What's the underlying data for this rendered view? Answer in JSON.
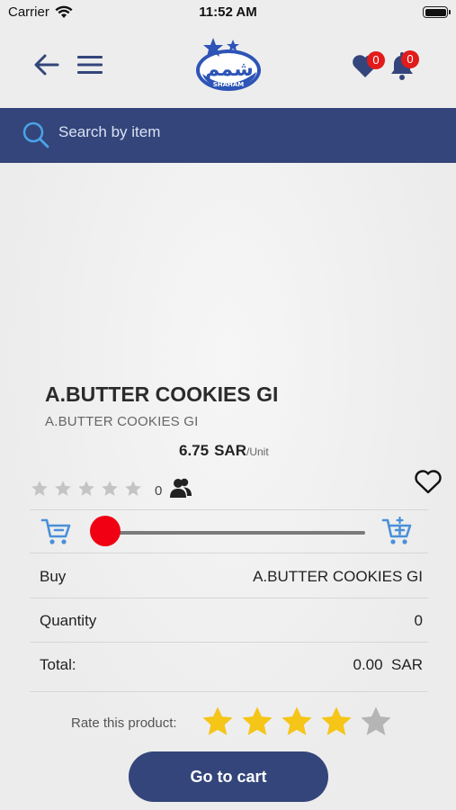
{
  "status_bar": {
    "carrier": "Carrier",
    "time": "11:52 AM"
  },
  "header": {
    "logo_text": "شمم",
    "logo_subtext": "SHAHAM",
    "favorites_count": "0",
    "notifications_count": "0"
  },
  "search": {
    "placeholder": "Search by item"
  },
  "product": {
    "name": "A.BUTTER COOKIES GI",
    "subtitle": "A.BUTTER COOKIES GI",
    "price": "6.75",
    "currency": "SAR",
    "unit": "/Unit",
    "rating_count": "0",
    "average_rating": 0,
    "quantity_slider_fraction": 0
  },
  "summary": {
    "buy_label": "Buy",
    "buy_value": "A.BUTTER COOKIES GI",
    "quantity_label": "Quantity",
    "quantity_value": "0",
    "total_label": "Total:",
    "total_value": "0.00  SAR"
  },
  "rate": {
    "label": "Rate this product:",
    "selected_stars": 4,
    "max_stars": 5
  },
  "cart_button": {
    "label": "Go to cart"
  },
  "colors": {
    "brand_navy": "#33457a",
    "accent_blue": "#4a90d9",
    "badge_red": "#e11b1b",
    "slider_red": "#f00012",
    "star_gold": "#f5c518",
    "star_gray": "#b5b5b5"
  },
  "icons": {
    "back": "arrow-left-icon",
    "menu": "hamburger-menu-icon",
    "favorites": "heart-icon",
    "notifications": "bell-icon",
    "search": "search-icon",
    "users": "users-icon",
    "cart_remove": "cart-remove-icon",
    "cart_add": "cart-add-icon"
  }
}
